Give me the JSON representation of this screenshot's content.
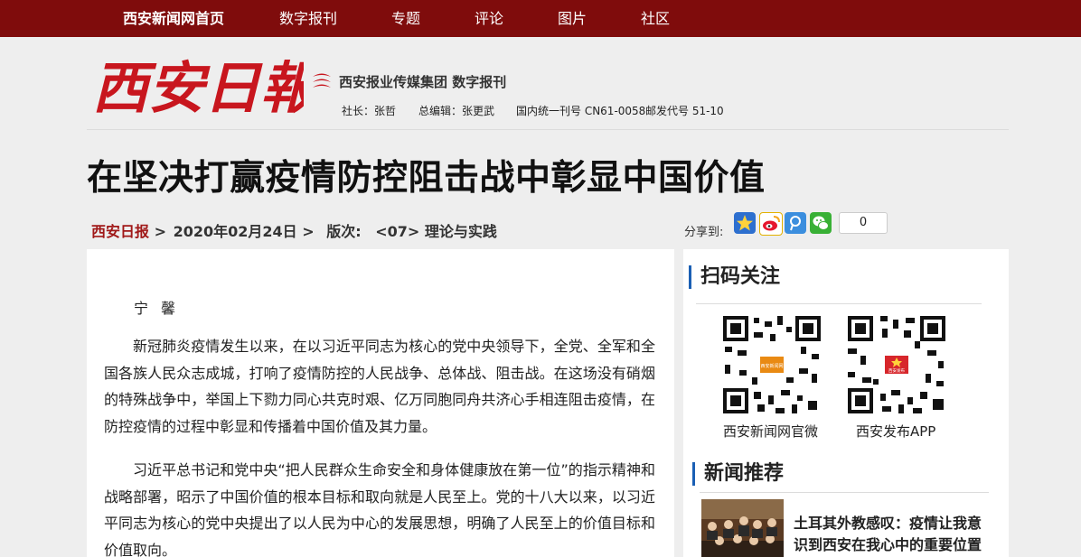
{
  "nav": {
    "home": "西安新闻网首页",
    "items": [
      "数字报刊",
      "专题",
      "评论",
      "图片",
      "社区"
    ]
  },
  "masthead": {
    "logo_text": "西安日報",
    "group_title": "西安报业传媒集团 数字报刊",
    "president": "社长：张哲",
    "editor": "总编辑：张更武",
    "serial": "国内统一刊号 CN61-0058",
    "postal": "邮发代号 51-10"
  },
  "article": {
    "headline": "在坚决打赢疫情防控阻击战中彰显中国价值",
    "breadcrumb": {
      "paper": "西安日报",
      "sep1": ">",
      "date": "2020年02月24日",
      "sep2": ">",
      "edition_label": "版次:",
      "edition": "<07> 理论与实践"
    },
    "author": "宁馨",
    "paragraphs": [
      "新冠肺炎疫情发生以来，在以习近平同志为核心的党中央领导下，全党、全军和全国各族人民众志成城，打响了疫情防控的人民战争、总体战、阻击战。在这场没有硝烟的特殊战争中，举国上下勠力同心共克时艰、亿万同胞同舟共济心手相连阻击疫情，在防控疫情的过程中彰显和传播着中国价值及其力量。",
      "习近平总书记和党中央“把人民群众生命安全和身体健康放在第一位”的指示精神和战略部署，昭示了中国价值的根本目标和取向就是人民至上。党的十八大以来，以习近平同志为核心的党中央提出了以人民为中心的发展思想，明确了人民至上的价值目标和价值取向。"
    ]
  },
  "share": {
    "label": "分享到:",
    "icons": [
      "qzone-icon",
      "weibo-icon",
      "tqq-icon",
      "wechat-icon"
    ],
    "count": "0"
  },
  "sidebar": {
    "qr_title": "扫码关注",
    "qr_items": [
      {
        "label": "西安新闻网官微",
        "badge": "西安新闻网"
      },
      {
        "label": "西安发布APP",
        "badge": "西安发布"
      }
    ],
    "news_title": "新闻推荐",
    "news_item": "土耳其外教感叹：疫情让我意识到西安在我心中的重要位置"
  },
  "colors": {
    "nav_bg": "#7f0c0c",
    "brand_red": "#c8161e",
    "accent_blue": "#1a5fb4"
  }
}
